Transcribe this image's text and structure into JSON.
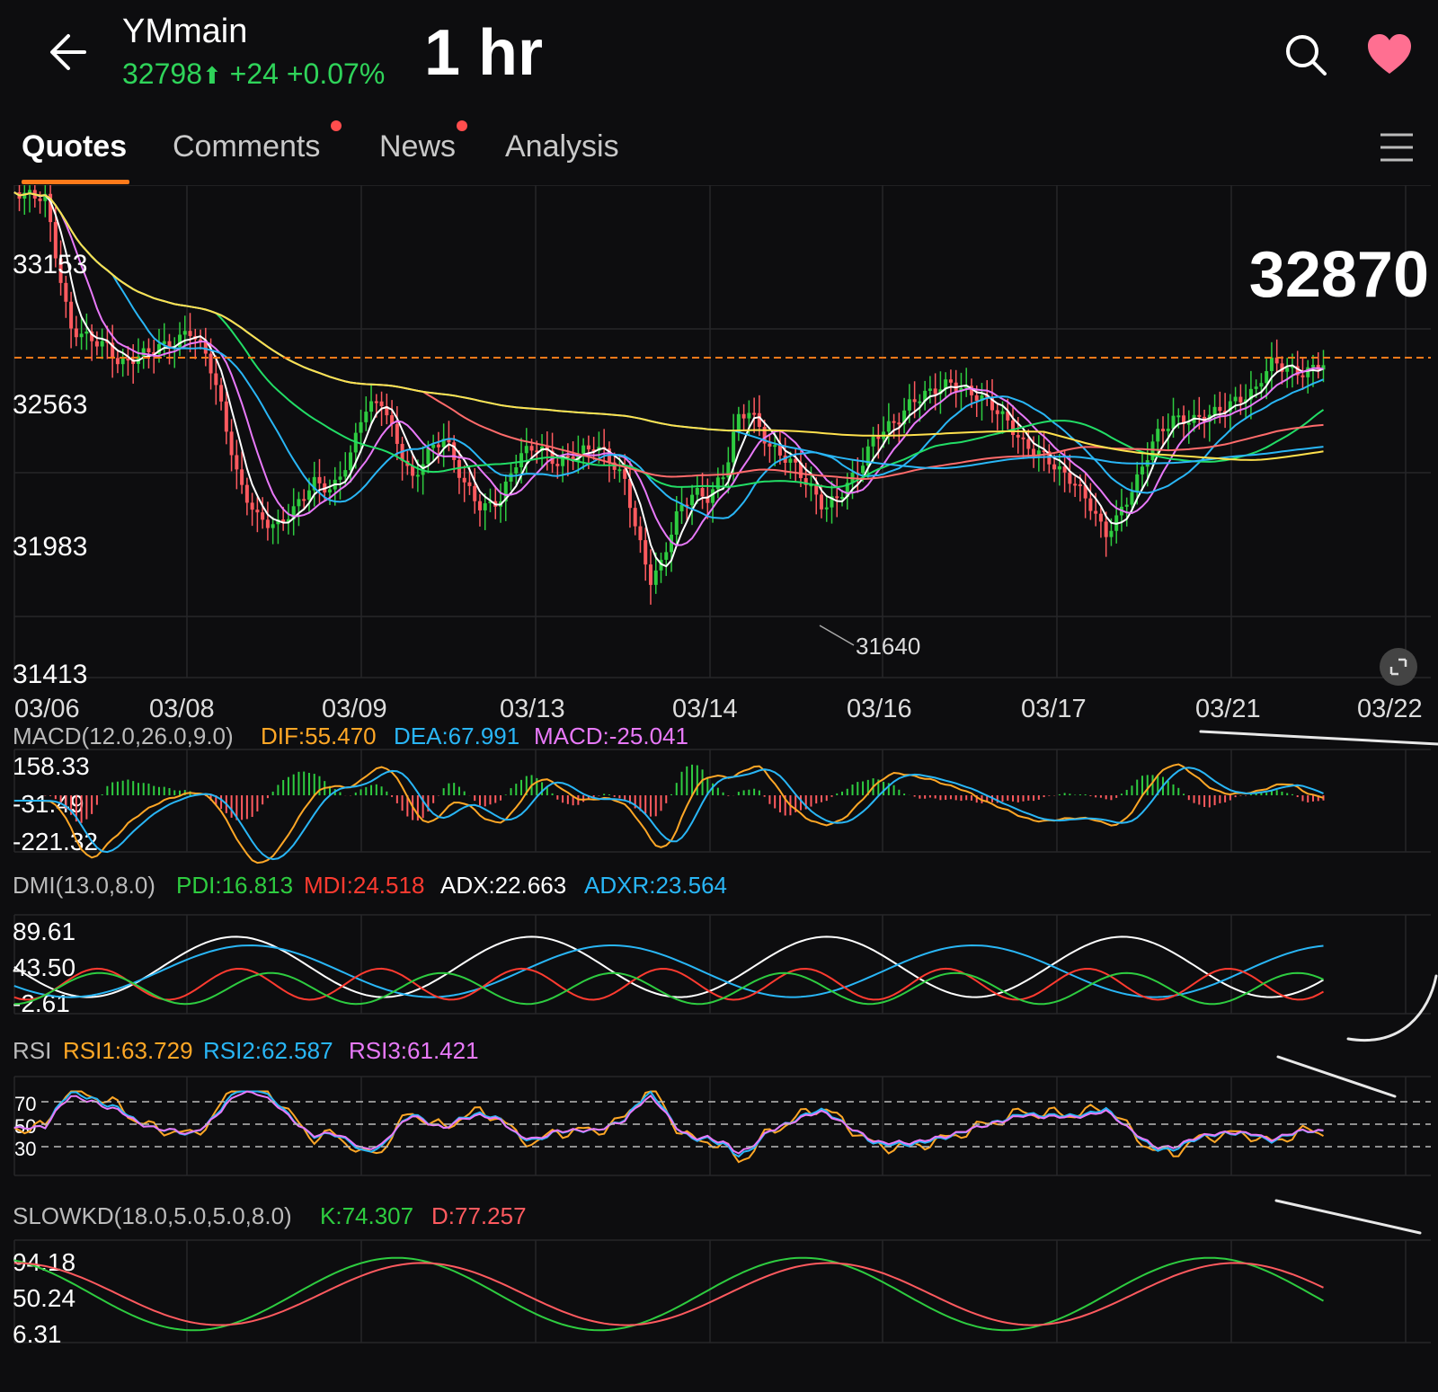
{
  "header": {
    "symbol": "YMmain",
    "price": "32798",
    "change": "+24",
    "change_pct": "+0.07%",
    "interval": "1 hr",
    "up_color": "#2fd45a"
  },
  "tabs": [
    {
      "label": "Quotes",
      "active": true,
      "dot": false
    },
    {
      "label": "Comments",
      "active": false,
      "dot": true
    },
    {
      "label": "News",
      "active": false,
      "dot": true
    },
    {
      "label": "Analysis",
      "active": false,
      "dot": false
    }
  ],
  "main": {
    "y_ticks": [
      "33153",
      "32563",
      "31983",
      "31413"
    ],
    "big_price": "32870",
    "low_annotation": "31640",
    "dates": [
      "03/06",
      "03/08",
      "03/09",
      "03/13",
      "03/14",
      "03/16",
      "03/17",
      "03/21",
      "03/22"
    ]
  },
  "macd": {
    "title": "MACD(12.0,26.0,9.0)",
    "dif": "DIF:55.470",
    "dea": "DEA:67.991",
    "macd": "MACD:-25.041",
    "ticks": [
      "158.33",
      "-31.49",
      "-221.32"
    ]
  },
  "dmi": {
    "title": "DMI(13.0,8.0)",
    "pdi": "PDI:16.813",
    "mdi": "MDI:24.518",
    "adx": "ADX:22.663",
    "adxr": "ADXR:23.564",
    "ticks": [
      "89.61",
      "43.50",
      "-2.61"
    ]
  },
  "rsi": {
    "title": "RSI",
    "rsi1": "RSI1:63.729",
    "rsi2": "RSI2:62.587",
    "rsi3": "RSI3:61.421",
    "ticks": [
      "70",
      "50",
      "30"
    ]
  },
  "kd": {
    "title": "SLOWKD(18.0,5.0,5.0,8.0)",
    "k": "K:74.307",
    "d": "D:77.257",
    "ticks": [
      "94.18",
      "50.24",
      "6.31"
    ]
  },
  "colors": {
    "up": "#2ecc40",
    "down": "#ff5a5f",
    "orange": "#ffa726",
    "cyan": "#29b6f6",
    "pink": "#e879f9",
    "yellow": "#ffe14d",
    "white": "#ffffff",
    "red": "#ff3b30"
  }
}
